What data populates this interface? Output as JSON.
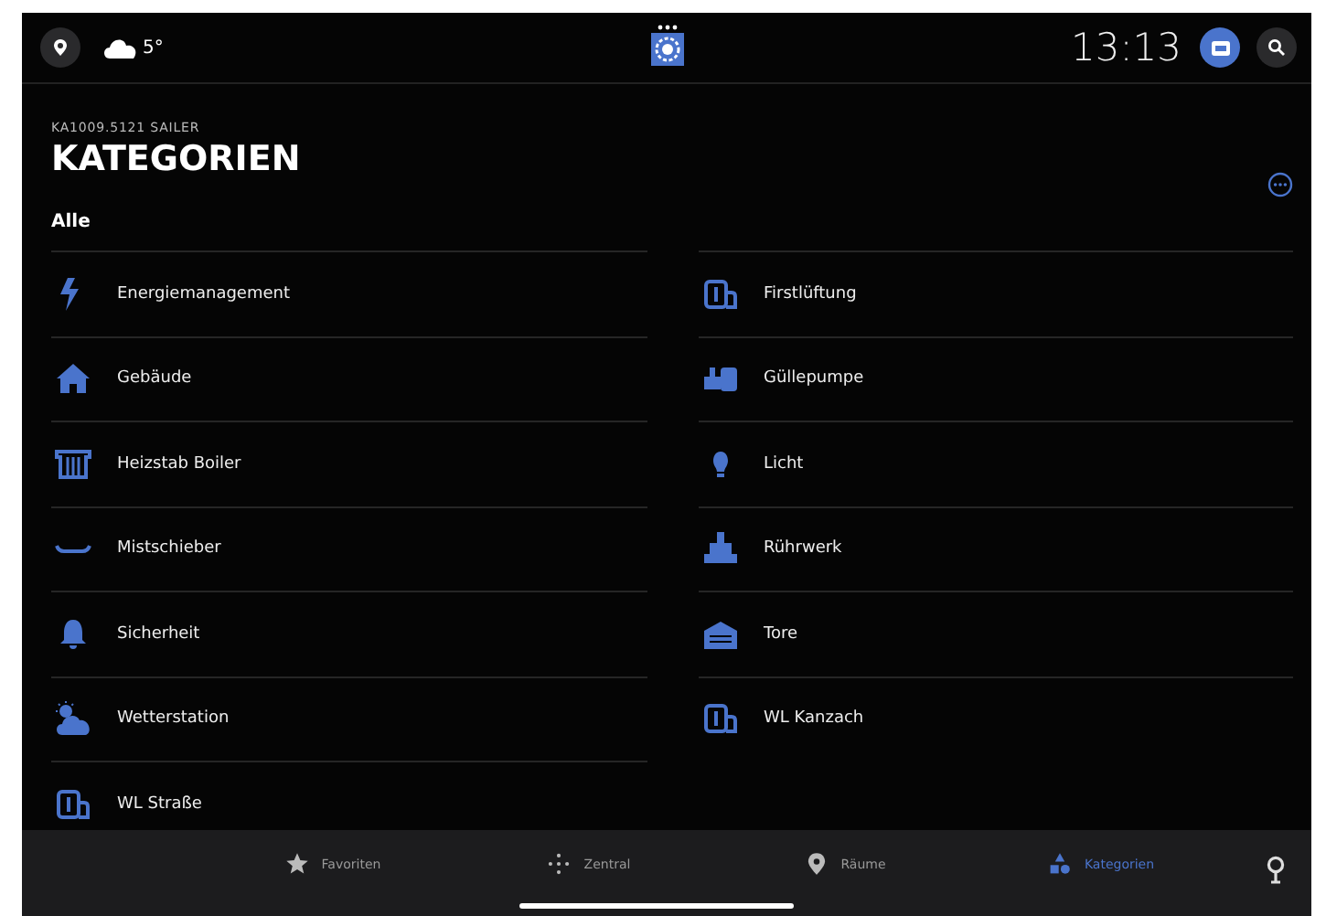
{
  "status_bar": {
    "temperature": "5°",
    "time": "13:13"
  },
  "header": {
    "subtitle": "KA1009.5121 SAILER",
    "title": "KATEGORIEN",
    "filter": "Alle"
  },
  "categories": [
    {
      "label": "Energiemanagement",
      "kind": "bolt"
    },
    {
      "label": "Firstlüftung",
      "kind": "vent"
    },
    {
      "label": "Gebäude",
      "kind": "house"
    },
    {
      "label": "Güllepumpe",
      "kind": "pump"
    },
    {
      "label": "Heizstab Boiler",
      "kind": "radiator"
    },
    {
      "label": "Licht",
      "kind": "bulb"
    },
    {
      "label": "Mistschieber",
      "kind": "scraper"
    },
    {
      "label": "Rührwerk",
      "kind": "mixer"
    },
    {
      "label": "Sicherheit",
      "kind": "bell"
    },
    {
      "label": "Tore",
      "kind": "garage"
    },
    {
      "label": "Wetterstation",
      "kind": "weather"
    },
    {
      "label": "WL Kanzach",
      "kind": "vent"
    },
    {
      "label": "WL Straße",
      "kind": "vent"
    }
  ],
  "tab_bar": [
    {
      "label": "Favoriten",
      "kind": "star",
      "selected": false
    },
    {
      "label": "Zentral",
      "kind": "dots",
      "selected": false
    },
    {
      "label": "Räume",
      "kind": "pin",
      "selected": false
    },
    {
      "label": "Kategorien",
      "kind": "shapes",
      "selected": true
    }
  ]
}
